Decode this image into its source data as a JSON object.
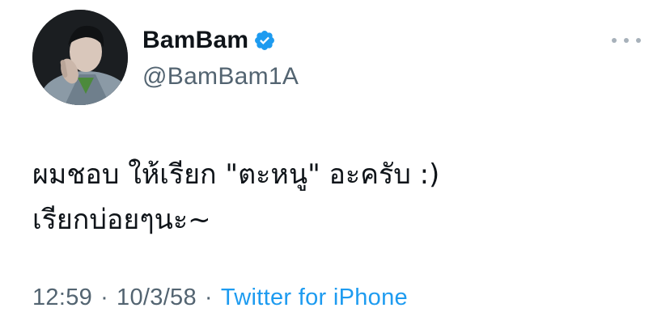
{
  "author": {
    "display_name": "BamBam",
    "handle": "@BamBam1A",
    "verified": true,
    "avatar_icon": "profile-photo"
  },
  "tweet": {
    "text_lines": [
      "ผมชอบ ให้เรียก \"ตะหนู\" อะครับ :)",
      "เรียกบ่อยๆนะ~"
    ]
  },
  "meta": {
    "time": "12:59",
    "separator": "·",
    "date": "10/3/58",
    "source": "Twitter for iPhone"
  },
  "colors": {
    "text": "#0f1419",
    "secondary": "#536471",
    "link": "#1d9bf0",
    "verified_badge": "#1d9bf0"
  }
}
